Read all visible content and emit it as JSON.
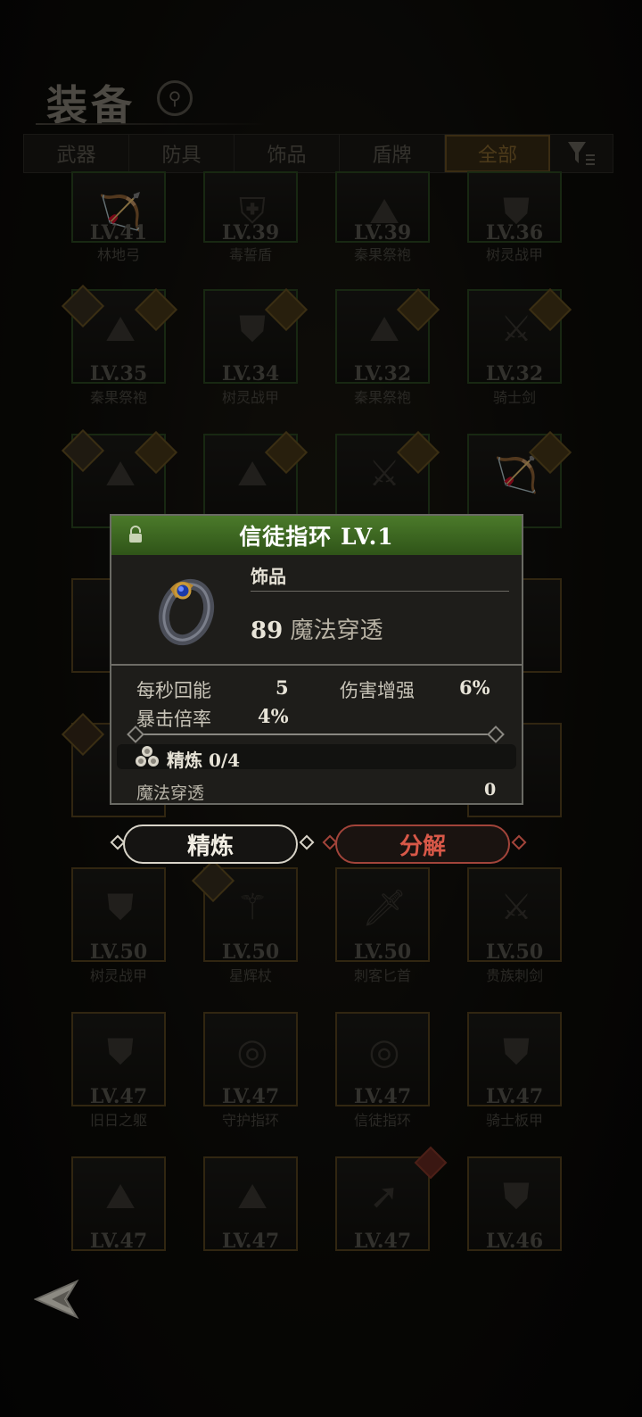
{
  "header": {
    "title": "装备",
    "search_icon": "magnifier-icon"
  },
  "tabs": [
    {
      "label": "武器",
      "active": false
    },
    {
      "label": "防具",
      "active": false
    },
    {
      "label": "饰品",
      "active": false
    },
    {
      "label": "盾牌",
      "active": false
    },
    {
      "label": "全部",
      "active": true
    }
  ],
  "filter_icon": "filter-icon",
  "grid": [
    {
      "level": "LV.41",
      "name": "林地弓"
    },
    {
      "level": "LV.39",
      "name": "毒誓盾"
    },
    {
      "level": "LV.39",
      "name": "秦果祭袍"
    },
    {
      "level": "LV.36",
      "name": "树灵战甲"
    },
    {
      "level": "LV.35",
      "name": "秦果祭袍"
    },
    {
      "level": "LV.34",
      "name": "树灵战甲"
    },
    {
      "level": "LV.32",
      "name": "秦果祭袍"
    },
    {
      "level": "LV.32",
      "name": "骑士剑"
    },
    {
      "level": "LV.50",
      "name": "树灵战甲"
    },
    {
      "level": "LV.50",
      "name": "星辉杖"
    },
    {
      "level": "LV.50",
      "name": "刺客匕首"
    },
    {
      "level": "LV.50",
      "name": "贵族刺剑"
    },
    {
      "level": "LV.47",
      "name": "旧日之躯"
    },
    {
      "level": "LV.47",
      "name": "守护指环"
    },
    {
      "level": "LV.47",
      "name": "信徒指环"
    },
    {
      "level": "LV.47",
      "name": "骑士板甲"
    },
    {
      "level": "LV.47",
      "name": ""
    },
    {
      "level": "LV.47",
      "name": ""
    },
    {
      "level": "LV.47",
      "name": ""
    },
    {
      "level": "LV.46",
      "name": ""
    }
  ],
  "popup": {
    "title": "信徒指环 LV.1",
    "lock_icon": "lock-icon",
    "item_icon": "ring-icon",
    "type": "饰品",
    "main_stat": {
      "value": "89",
      "label": "魔法穿透"
    },
    "stats": [
      {
        "label": "每秒回能",
        "value": "5"
      },
      {
        "label": "伤害增强",
        "value": "6%"
      },
      {
        "label": "暴击倍率",
        "value": "4%"
      }
    ],
    "refine": {
      "label": "精炼 0/4"
    },
    "refine_stat": {
      "label": "魔法穿透",
      "value": "0"
    }
  },
  "buttons": {
    "refine": "精炼",
    "dismantle": "分解"
  },
  "colors": {
    "header_green": "#3f6a22",
    "dismantle_red": "#d85848"
  }
}
